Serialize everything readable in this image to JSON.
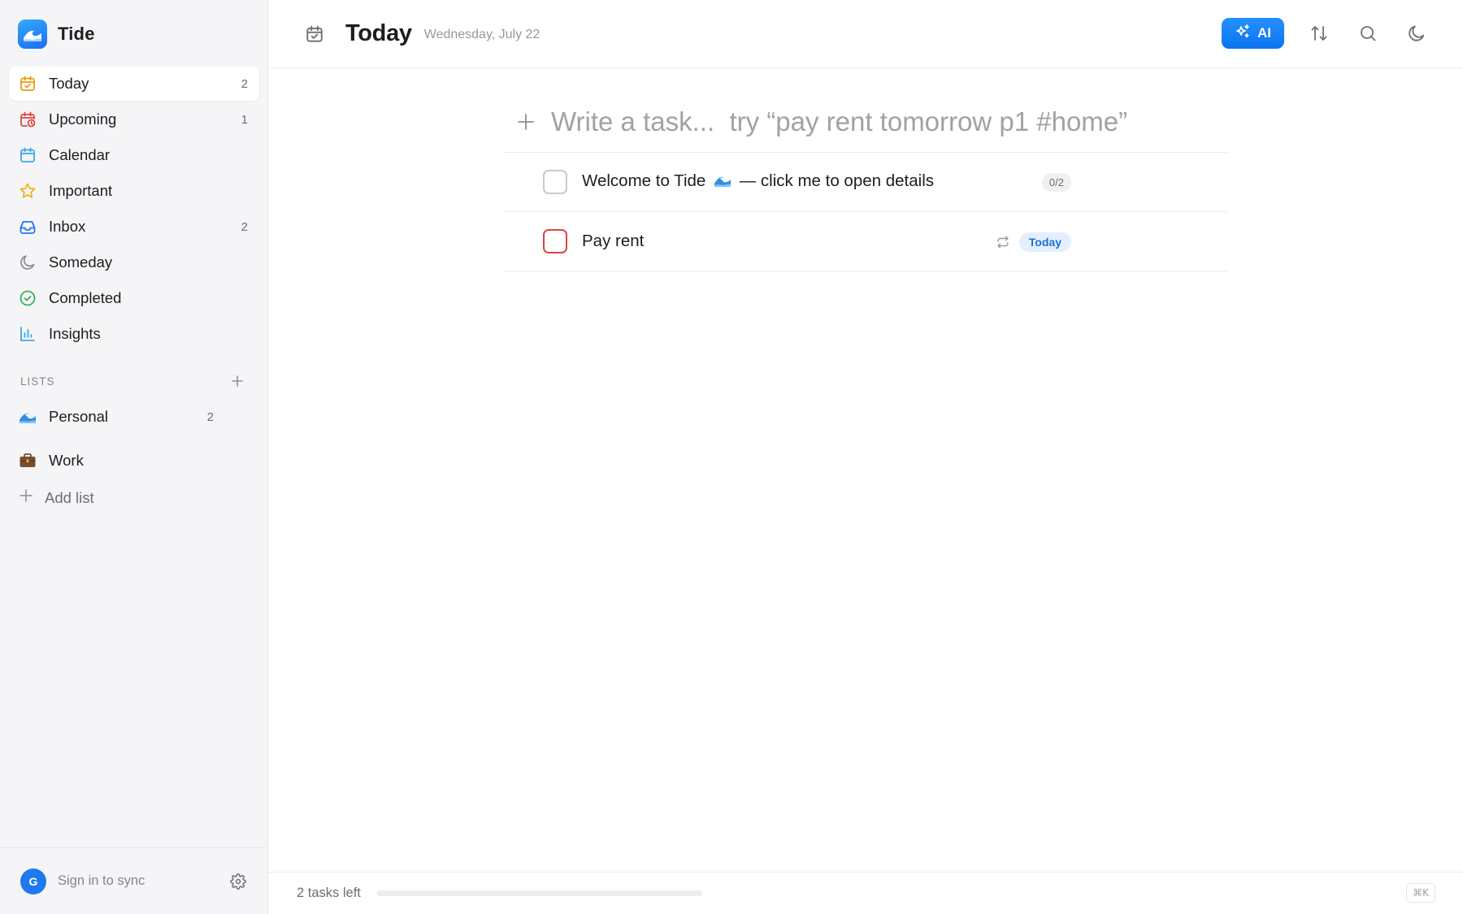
{
  "app": {
    "name": "Tide"
  },
  "colors": {
    "accent": "#1e78f0",
    "priority": "#e0443e",
    "today_chip_bg": "#e3efff"
  },
  "sidebar": {
    "nav": [
      {
        "label": "Today",
        "count": "2",
        "icon": "calendar-check-icon",
        "active": true
      },
      {
        "label": "Upcoming",
        "count": "1",
        "icon": "calendar-clock-icon"
      },
      {
        "label": "Calendar",
        "count": "",
        "icon": "calendar-icon"
      },
      {
        "label": "Important",
        "count": "",
        "icon": "star-icon"
      },
      {
        "label": "Inbox",
        "count": "2",
        "icon": "inbox-icon"
      },
      {
        "label": "Someday",
        "count": "",
        "icon": "moon-icon"
      },
      {
        "label": "Completed",
        "count": "",
        "icon": "check-circle-icon"
      },
      {
        "label": "Insights",
        "count": "",
        "icon": "bar-chart-icon"
      }
    ],
    "lists_title": "LISTS",
    "lists": [
      {
        "label": "Personal",
        "count": "2",
        "icon": "wave-emoji-icon"
      },
      {
        "label": "Work",
        "count": "",
        "icon": "briefcase-emoji-icon"
      }
    ],
    "add_list_label": "Add list",
    "footer": {
      "avatar_initial": "G",
      "sync_label": "Sign in to sync"
    }
  },
  "header": {
    "title": "Today",
    "date": "Wednesday, July 22",
    "ai_label": "AI"
  },
  "composer": {
    "placeholder": "Write a task...  try “pay rent tomorrow p1 #home”"
  },
  "tasks": [
    {
      "title_before": "Welcome to Tide",
      "title_after": "— click me to open details",
      "subtasks": "0/2",
      "priority": false
    },
    {
      "title": "Pay rent",
      "date_chip": "Today",
      "repeat": true,
      "priority": true
    }
  ],
  "status": {
    "tasks_left": "2 tasks left",
    "progress": 0.0,
    "shortcut": "⌘K"
  }
}
